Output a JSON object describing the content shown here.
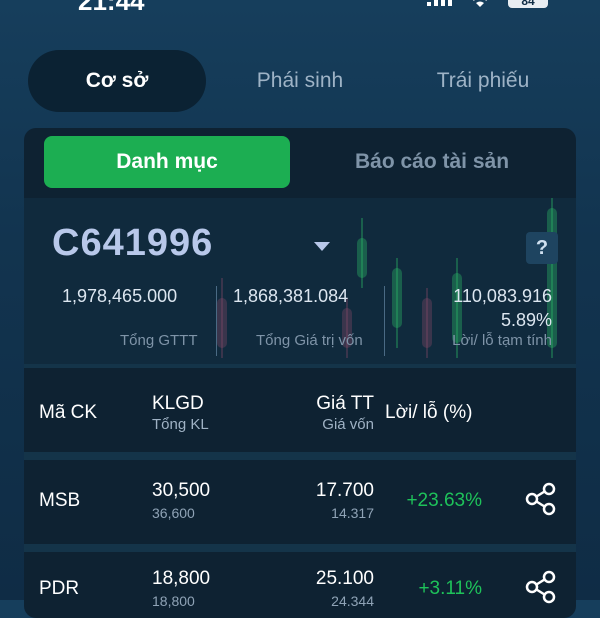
{
  "status_bar": {
    "time": "21:44",
    "battery": "84"
  },
  "top_tabs": [
    {
      "label": "Cơ sở"
    },
    {
      "label": "Phái sinh"
    },
    {
      "label": "Trái phiếu"
    }
  ],
  "sub_tabs": [
    {
      "label": "Danh mục"
    },
    {
      "label": "Báo cáo tài sản"
    }
  ],
  "account": {
    "id": "C641996",
    "help": "?"
  },
  "summary": {
    "market_value": "1,978,465.000",
    "market_value_label": "Tổng GTTT",
    "cost_value": "1,868,381.084",
    "cost_value_label": "Tổng Giá trị vốn",
    "pnl_value": "110,083.916",
    "pnl_percent": "5.89%",
    "pnl_label": "Lời/ lỗ tạm tính"
  },
  "table": {
    "headers": {
      "symbol": "Mã CK",
      "volume": "KLGD",
      "volume_sub": "Tổng KL",
      "price": "Giá TT",
      "price_sub": "Giá vốn",
      "pnl": "Lời/ lỗ (%)"
    },
    "rows": [
      {
        "symbol": "MSB",
        "volume": "30,500",
        "total_volume": "36,600",
        "price": "17.700",
        "cost": "14.317",
        "pnl": "+23.63%"
      },
      {
        "symbol": "PDR",
        "volume": "18,800",
        "total_volume": "18,800",
        "price": "25.100",
        "cost": "24.344",
        "pnl": "+3.11%"
      }
    ]
  },
  "colors": {
    "accent_green": "#1cae52",
    "gain_green": "#1ec25a",
    "background": "#12344f"
  },
  "icons": [
    "wifi-icon",
    "signal-icon",
    "battery-icon",
    "caret-down-icon",
    "help-icon",
    "share-icon"
  ]
}
